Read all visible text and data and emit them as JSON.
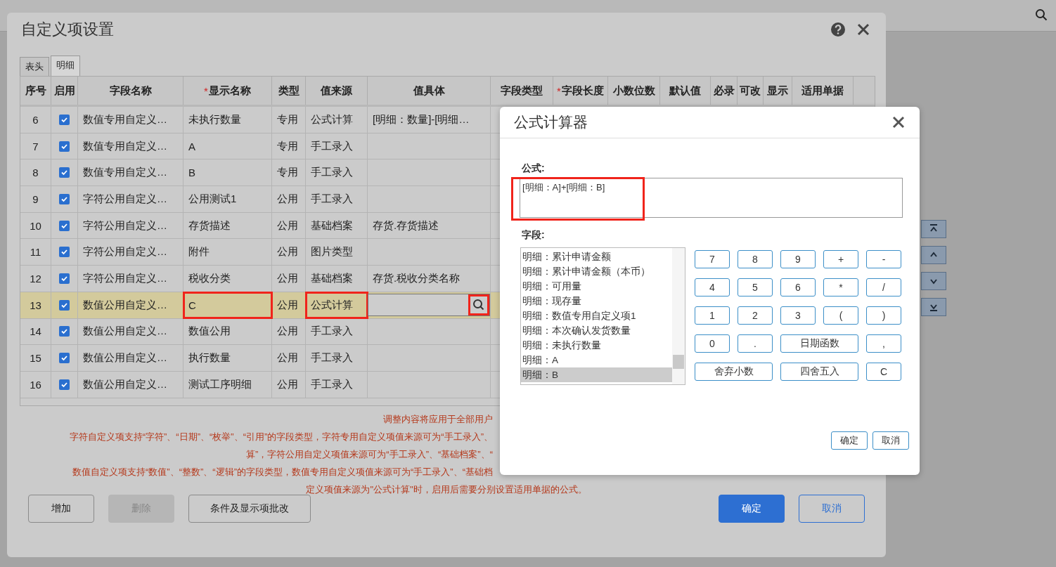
{
  "background": {
    "side_buttons": [
      {
        "kind": "top"
      },
      {
        "kind": "up"
      },
      {
        "kind": "down"
      },
      {
        "kind": "bottom"
      }
    ]
  },
  "dialog": {
    "title": "自定义项设置",
    "tabs": [
      {
        "label": "表头",
        "selected": false
      },
      {
        "label": "明细",
        "selected": true
      }
    ],
    "columns": [
      {
        "label": "序号"
      },
      {
        "label": "启用"
      },
      {
        "label": "字段名称"
      },
      {
        "label": "显示名称",
        "required_mark": "*"
      },
      {
        "label": "类型"
      },
      {
        "label": "值来源"
      },
      {
        "label": "值具体"
      },
      {
        "label": "字段类型"
      },
      {
        "label": "字段长度",
        "required_mark": "*"
      },
      {
        "label": "小数位数"
      },
      {
        "label": "默认值"
      },
      {
        "label": "必录"
      },
      {
        "label": "可改"
      },
      {
        "label": "显示"
      },
      {
        "label": "适用单据"
      }
    ],
    "rows": [
      {
        "no": "6",
        "enabled": true,
        "field_name": "数值专用自定义…",
        "display_name": "未执行数量",
        "type": "专用",
        "value_source": "公式计算",
        "value_detail": "[明细：数量]-[明细…",
        "selected": false,
        "editing": false,
        "annotated": false
      },
      {
        "no": "7",
        "enabled": true,
        "field_name": "数值专用自定义…",
        "display_name": "A",
        "type": "专用",
        "value_source": "手工录入",
        "selected": false,
        "editing": false,
        "annotated": false
      },
      {
        "no": "8",
        "enabled": true,
        "field_name": "数值专用自定义…",
        "display_name": "B",
        "type": "专用",
        "value_source": "手工录入",
        "selected": false,
        "editing": false,
        "annotated": false
      },
      {
        "no": "9",
        "enabled": true,
        "field_name": "字符公用自定义…",
        "display_name": "公用测试1",
        "type": "公用",
        "value_source": "手工录入",
        "selected": false,
        "editing": false,
        "annotated": false
      },
      {
        "no": "10",
        "enabled": true,
        "field_name": "字符公用自定义…",
        "display_name": "存货描述",
        "type": "公用",
        "value_source": "基础档案",
        "value_detail": "存货.存货描述",
        "selected": false,
        "editing": false,
        "annotated": false
      },
      {
        "no": "11",
        "enabled": true,
        "field_name": "字符公用自定义…",
        "display_name": "附件",
        "type": "公用",
        "value_source": "图片类型",
        "selected": false,
        "editing": false,
        "annotated": false
      },
      {
        "no": "12",
        "enabled": true,
        "field_name": "字符公用自定义…",
        "display_name": "税收分类",
        "type": "公用",
        "value_source": "基础档案",
        "value_detail": "存货.税收分类名称",
        "selected": false,
        "editing": false,
        "annotated": false
      },
      {
        "no": "13",
        "enabled": true,
        "field_name": "数值公用自定义…",
        "display_name": "C",
        "type": "公用",
        "value_source": "公式计算",
        "selected": true,
        "editing": true,
        "annotated": true
      },
      {
        "no": "14",
        "enabled": true,
        "field_name": "数值公用自定义…",
        "display_name": "数值公用",
        "type": "公用",
        "value_source": "手工录入",
        "selected": false,
        "editing": false,
        "annotated": false
      },
      {
        "no": "15",
        "enabled": true,
        "field_name": "数值公用自定义…",
        "display_name": "执行数量",
        "type": "公用",
        "value_source": "手工录入",
        "selected": false,
        "editing": false,
        "annotated": false
      },
      {
        "no": "16",
        "enabled": true,
        "field_name": "数值公用自定义…",
        "display_name": "测试工序明细",
        "type": "公用",
        "value_source": "手工录入",
        "selected": false,
        "editing": false,
        "annotated": false
      }
    ],
    "notes": [
      {
        "text": "调整内容将应用于全部用户",
        "cut": true
      },
      {
        "text": "字符自定义项支持“字符”、“日期”、“枚举”、“引用”的字段类型，字符专用自定义项值来源可为“手工录入”、",
        "cut": true
      },
      {
        "text": "算”，字符公用自定义项值来源可为“手工录入”、“基础档案”、“",
        "cut": true
      },
      {
        "text": "数值自定义项支持“数值”、“整数”、“逻辑”的字段类型，数值专用自定义项值来源可为“手工录入”、“基础档",
        "cut": true
      },
      {
        "text": "定义项值来源为\"公式计算\"时，启用后需要分别设置适用单据的公式。",
        "cut": false
      }
    ],
    "buttons": [
      {
        "label": "增加",
        "kind": "normal",
        "disabled": false
      },
      {
        "label": "删除",
        "kind": "normal",
        "disabled": true
      },
      {
        "label": "条件及显示项批改",
        "kind": "normal",
        "disabled": false
      },
      {
        "label": "确定",
        "kind": "primary",
        "disabled": false
      },
      {
        "label": "取消",
        "kind": "secondary",
        "disabled": false
      }
    ]
  },
  "calculator": {
    "title": "公式计算器",
    "formula_label": "公式:",
    "formula": "[明细：A]+[明细：B]",
    "formula_annotated": true,
    "fields_label": "字段:",
    "fields": [
      {
        "label": "明细：累计申请金额",
        "selected": false
      },
      {
        "label": "明细：累计申请金额（本币）",
        "selected": false
      },
      {
        "label": "明细：可用量",
        "selected": false
      },
      {
        "label": "明细：现存量",
        "selected": false
      },
      {
        "label": "明细：数值专用自定义项1",
        "selected": false
      },
      {
        "label": "明细：本次确认发货数量",
        "selected": false
      },
      {
        "label": "明细：未执行数量",
        "selected": false
      },
      {
        "label": "明细：A",
        "selected": false
      },
      {
        "label": "明细：B",
        "selected": true
      }
    ],
    "keys": [
      {
        "label": "7",
        "wide": false
      },
      {
        "label": "8",
        "wide": false
      },
      {
        "label": "9",
        "wide": false
      },
      {
        "label": "+",
        "wide": false
      },
      {
        "label": "-",
        "wide": false
      },
      {
        "label": "4",
        "wide": false
      },
      {
        "label": "5",
        "wide": false
      },
      {
        "label": "6",
        "wide": false
      },
      {
        "label": "*",
        "wide": false
      },
      {
        "label": "/",
        "wide": false
      },
      {
        "label": "1",
        "wide": false
      },
      {
        "label": "2",
        "wide": false
      },
      {
        "label": "3",
        "wide": false
      },
      {
        "label": "(",
        "wide": false
      },
      {
        "label": ")",
        "wide": false
      },
      {
        "label": "0",
        "wide": false
      },
      {
        "label": ".",
        "wide": false
      },
      {
        "label": "日期函数",
        "wide": true
      },
      {
        "label": ",",
        "wide": false
      },
      {
        "label": "舍弃小数",
        "wide": true
      },
      {
        "label": "四舍五入",
        "wide": true
      },
      {
        "label": "C",
        "wide": false
      }
    ],
    "buttons": [
      "确定",
      "取消"
    ]
  }
}
